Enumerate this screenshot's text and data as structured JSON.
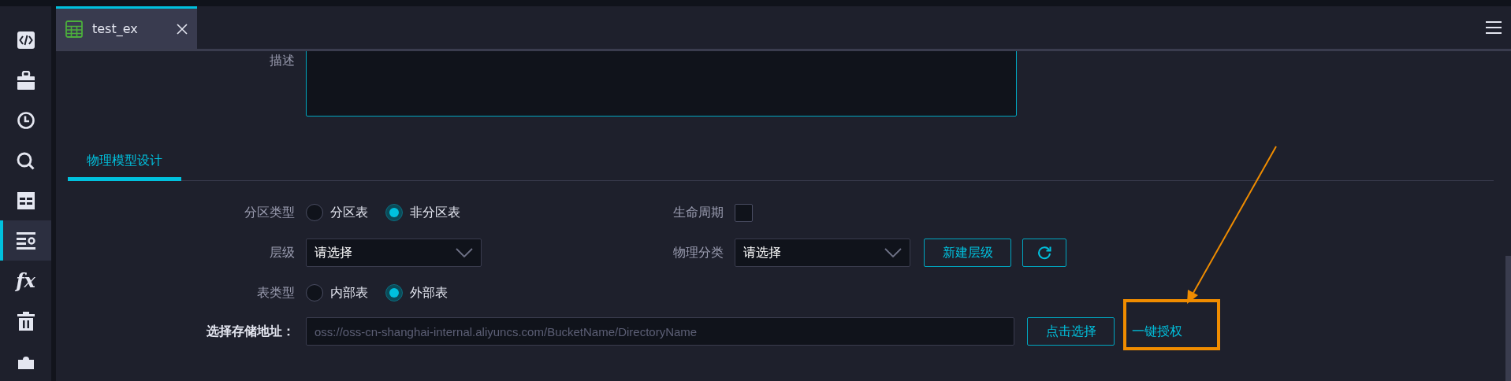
{
  "sidebar": {
    "items": [
      {
        "kind": "code",
        "selected": false
      },
      {
        "kind": "toolbox",
        "selected": false
      },
      {
        "kind": "clock",
        "selected": false
      },
      {
        "kind": "search",
        "selected": false
      },
      {
        "kind": "table",
        "selected": false
      },
      {
        "kind": "list-settings",
        "selected": true
      },
      {
        "kind": "function",
        "glyph": "fx",
        "selected": false
      },
      {
        "kind": "trash",
        "selected": false
      },
      {
        "kind": "puzzle",
        "selected": false
      }
    ]
  },
  "tabs": [
    {
      "title": "test_ex",
      "selected": true
    }
  ],
  "description": {
    "label": "描述"
  },
  "section_tabs": [
    {
      "label": "物理模型设计",
      "selected": true
    }
  ],
  "form": {
    "partition_type": {
      "label": "分区类型",
      "options": [
        {
          "label": "分区表",
          "selected": false
        },
        {
          "label": "非分区表",
          "selected": true
        }
      ]
    },
    "lifecycle": {
      "label": "生命周期",
      "checked": false
    },
    "level": {
      "label": "层级",
      "value": "请选择"
    },
    "physical_category": {
      "label": "物理分类",
      "value": "请选择"
    },
    "new_level_button": "新建层级",
    "table_type": {
      "label": "表类型",
      "options": [
        {
          "label": "内部表",
          "selected": false
        },
        {
          "label": "外部表",
          "selected": true
        }
      ]
    },
    "storage": {
      "label": "选择存储地址：",
      "placeholder": "oss://oss-cn-shanghai-internal.aliyuncs.com/BucketName/DirectoryName",
      "button": "点击选择",
      "link": "一键授权"
    }
  }
}
